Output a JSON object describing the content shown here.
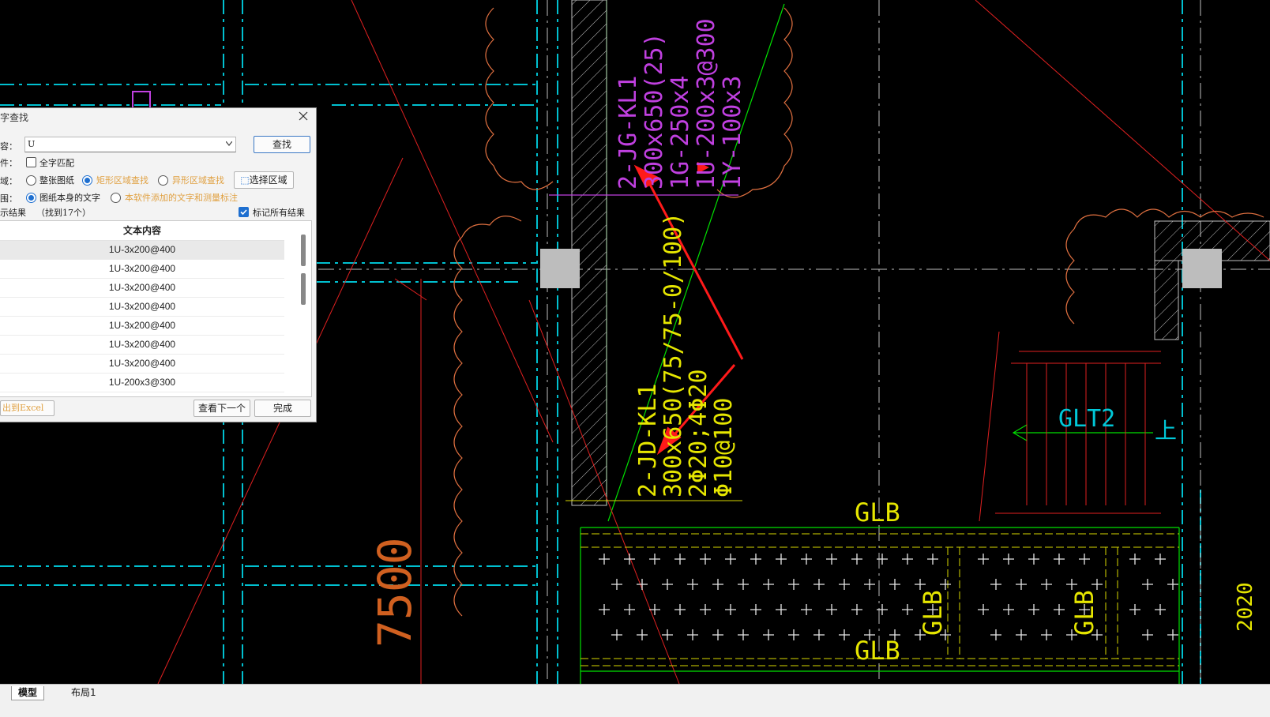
{
  "dialog": {
    "title": "文字查找",
    "title_visible": "字查找",
    "content_label": "容：",
    "content_value": "U",
    "search_button": "查找",
    "condition_label": "件：",
    "full_match_label": "全字匹配",
    "area_label": "域：",
    "area_options": [
      "整张图纸",
      "矩形区域查找",
      "异形区域查找"
    ],
    "select_area_button": "选择区域",
    "scope_label": "围：",
    "scope_options": [
      "图纸本身的文字",
      "本软件添加的文字和测量标注"
    ],
    "results_label": "示结果",
    "results_count": "（找到17个）",
    "mark_all_label": "标记所有结果",
    "table_header": "文本内容",
    "rows": [
      "1U-3x200@400",
      "1U-3x200@400",
      "1U-3x200@400",
      "1U-3x200@400",
      "1U-3x200@400",
      "1U-3x200@400",
      "1U-3x200@400",
      "1U-200x3@300"
    ],
    "export_button": "出到Excel",
    "next_button": "查看下一个",
    "done_button": "完成"
  },
  "drawing": {
    "beam_magenta_1": "2-JG-KL1",
    "beam_magenta_2": "300x650(25)",
    "beam_magenta_3": "1G-250x4",
    "beam_magenta_4": "1U-200x3@300",
    "beam_magenta_5": "1Y-100x3",
    "beam_yellow_1": "2-JD-KL1",
    "beam_yellow_2": "300x650(75/75-0/100)",
    "beam_yellow_3": "2Φ20;4Φ20",
    "beam_yellow_4": "Φ10@100",
    "glt2": "GLT2",
    "glb_top": "GLB",
    "glb_bottom": "GLB",
    "glb_v1": "GLB",
    "glb_v2": "GLB",
    "dim_7500": "7500",
    "dim_2020": "2020",
    "up_mark": "上"
  },
  "tabs": [
    "模型",
    "布局1"
  ],
  "colors": {
    "cyan": "#00c8d8",
    "green": "#00ff00",
    "red": "#ff2020",
    "magenta": "#c040e0",
    "yellow": "#e6e600",
    "orange": "#d06020",
    "white": "#ffffff",
    "accent": "#1e6fd0"
  }
}
